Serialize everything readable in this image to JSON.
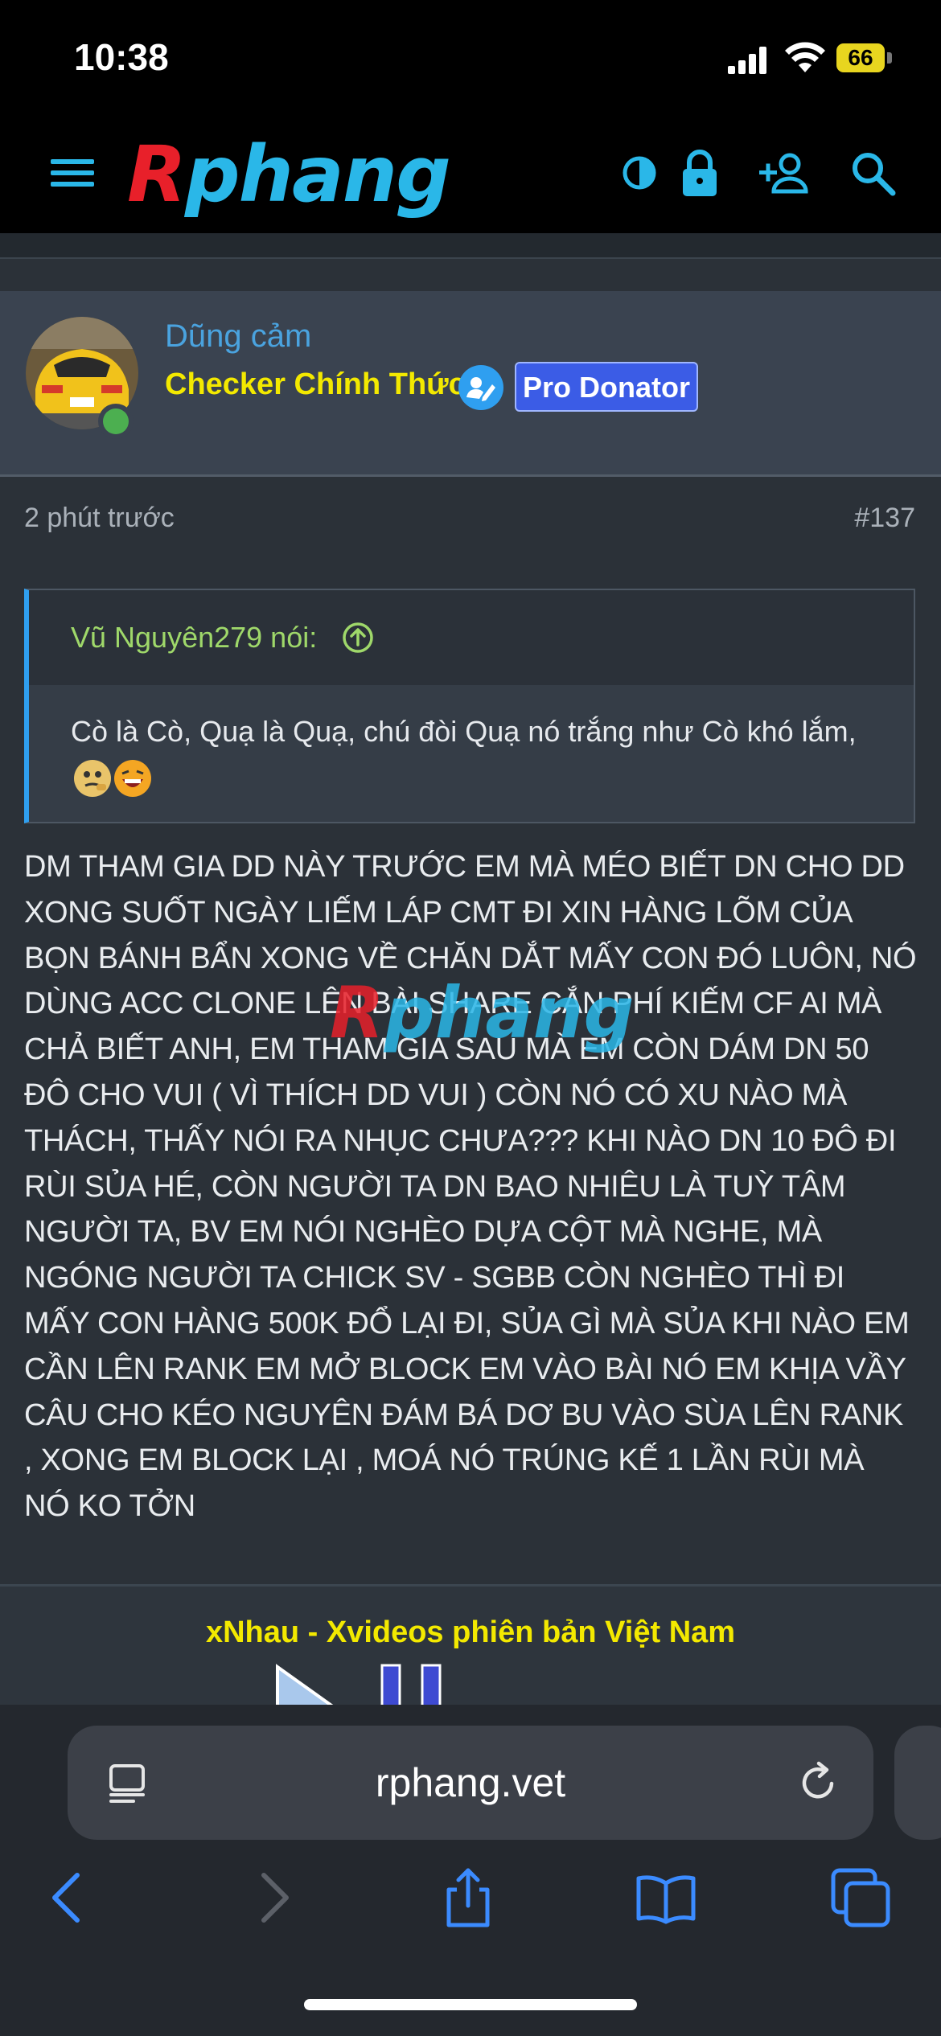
{
  "status_bar": {
    "time": "10:38",
    "battery": "66"
  },
  "header": {
    "logo_first": "R",
    "logo_rest": "phang",
    "icons": [
      "menu-icon",
      "theme-toggle-icon",
      "lock-icon",
      "register-icon",
      "search-icon"
    ]
  },
  "post": {
    "username": "Dũng cảm",
    "user_title": "Checker Chính Thức",
    "badge": "Pro Donator",
    "time": "2 phút trước",
    "number": "#137",
    "quote": {
      "author": "Vũ Nguyên279 nói:",
      "text": "Cò là Cò, Quạ là Quạ, chú đòi Quạ nó trắng như Cò khó lắm,"
    },
    "body": "DM THAM GIA DD NÀY TRƯỚC EM MÀ MÉO BIẾT DN CHO DD XONG SUỐT NGÀY LIẾM LÁP CMT ĐI XIN HÀNG LÕM CỦA BỌN BÁNH BẨN XONG VỀ CHĂN DẮT MẤY CON ĐÓ LUÔN, NÓ DÙNG ACC CLONE LÊN BÀI SHARE CẮN PHÍ KIẾM CF AI MÀ CHẢ BIẾT ANH, EM THAM GIA SAU MÀ EM CÒN DÁM DN 50 ĐÔ CHO VUI ( VÌ THÍCH DD VUI ) CÒN NÓ CÓ XU NÀO MÀ THÁCH, THẤY NÓI RA NHỤC CHƯA??? KHI NÀO DN 10 ĐÔ ĐI RÙI SỦA HÉ, CÒN NGƯỜI TA DN BAO NHIÊU LÀ TUỲ TÂM NGƯỜI TA, BV EM NÓI NGHÈO DỰA CỘT MÀ NGHE, MÀ NGÓNG NGƯỜI TA CHICK SV - SGBB CÒN NGHÈO THÌ ĐI MẤY CON HÀNG 500K ĐỔ LẠI ĐI, SỦA GÌ MÀ SỦA KHI NÀO EM CẦN LÊN RANK EM MỞ BLOCK EM VÀO BÀI NÓ EM KHỊA VẦY CÂU CHO KÉO NGUYÊN ĐÁM BÁ DƠ BU VÀO SÙA LÊN RANK , XONG EM BLOCK LẠI , MOÁ NÓ TRÚNG KẾ 1 LẦN RÙI MÀ NÓ KO TỞN"
  },
  "ad": {
    "title": "xNhau - Xvideos phiên bản Việt Nam"
  },
  "browser": {
    "url": "rphang.vet",
    "toolbar": [
      "back-icon",
      "forward-icon",
      "share-icon",
      "bookmarks-icon",
      "tabs-icon"
    ]
  },
  "colors": {
    "accent": "#2ab7e8",
    "logo_red": "#e8202a",
    "user_title": "#f3e900",
    "quote_author": "#9fd86a",
    "badge": "#3b5ce6"
  }
}
